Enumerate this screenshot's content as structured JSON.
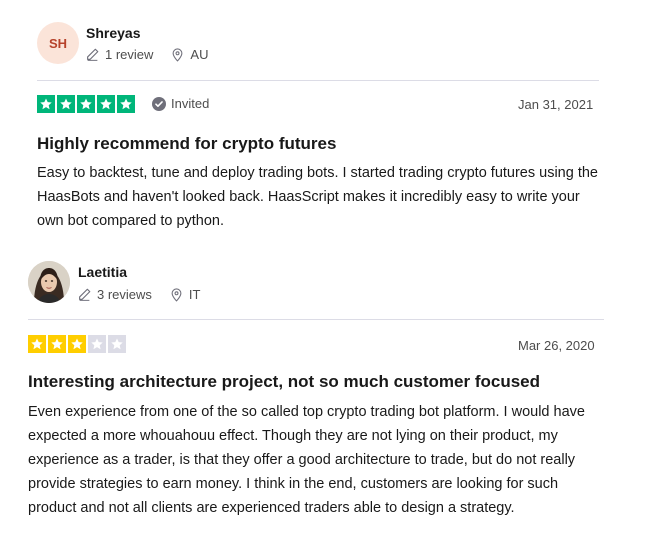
{
  "reviews": [
    {
      "avatar_initials": "SH",
      "name": "Shreyas",
      "review_count": "1 review",
      "country": "AU",
      "rating": 5,
      "star_color": "#00b67a",
      "invited_label": "Invited",
      "date": "Jan 31, 2021",
      "title": "Highly recommend for crypto futures",
      "body": "Easy to backtest, tune and deploy trading bots. I started trading crypto futures using the HaasBots and haven't looked back. HaasScript makes it incredibly easy to write your own bot compared to python."
    },
    {
      "avatar_initials": "",
      "name": "Laetitia",
      "review_count": "3 reviews",
      "country": "IT",
      "rating": 3,
      "star_color": "#ffce00",
      "date": "Mar 26, 2020",
      "title": "Interesting architecture project, not so much customer focused",
      "body": "Even experience from one of the so called top crypto trading bot platform. I would have expected a more whouahouu effect. Though they are not lying on their product, my experience as a trader, is that they offer a good architecture to trade, but do not really provide strategies to earn money. I think in the end, customers are looking for such product and not all clients are experienced traders able to design a strategy."
    }
  ],
  "colors": {
    "empty_star": "#dcdce6",
    "invited_badge": "#6f6f7a"
  },
  "icons": {
    "review_count": "pencil-icon",
    "country": "location-pin-icon",
    "invited": "check-circle-icon",
    "star": "star-icon"
  }
}
